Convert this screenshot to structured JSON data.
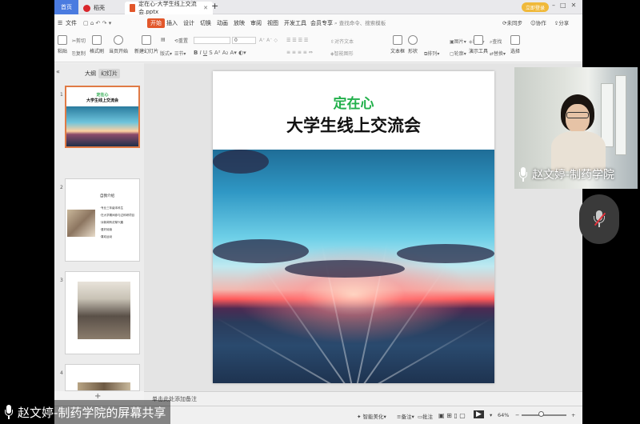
{
  "tabs": {
    "home": "首页",
    "daoke": "稻壳",
    "document": "定在心-大学生线上交流会.pptx",
    "login": "立即登录"
  },
  "menu": {
    "file": "文件",
    "start": "开始",
    "insert": "插入",
    "design": "设计",
    "transition": "切换",
    "animation": "动画",
    "slideshow": "放映",
    "review": "审阅",
    "view": "视图",
    "developer": "开发工具",
    "member": "会员专享",
    "search": "查找命令、搜索模板",
    "sync": "未同步",
    "collab": "协作",
    "share": "分享"
  },
  "ribbon": {
    "paste": "粘贴",
    "cut": "剪切",
    "copy": "复制",
    "format_painter": "格式刷",
    "start_from_current": "当页开始",
    "new_slide": "新建幻灯片",
    "layout": "版式",
    "section": "节",
    "reset": "重置",
    "font_size_value": "0",
    "text_box": "文本框",
    "shape": "形状",
    "arrange": "排列",
    "outline": "轮廓",
    "picture": "图片",
    "fill": "填充",
    "find": "查找",
    "replace": "替换",
    "select": "选择",
    "presentation_tool": "演示工具",
    "smart_shape": "智能图形",
    "text_align": "对齐文本"
  },
  "left_panel": {
    "outline_tab": "大纲",
    "slides_tab": "幻灯片",
    "slide_numbers": [
      "1",
      "2",
      "3",
      "4"
    ],
    "thumb1_title1": "定在心",
    "thumb1_title2": "大学生线上交流会",
    "thumb2_title": "自我介绍",
    "thumb2_items": [
      "·专业三年级本科生",
      "·在大学期间参与过科研项目",
      "·对新闻有浓厚兴趣",
      "·爱好阅读",
      "·喜欢运动"
    ],
    "add_icon": "+"
  },
  "slide": {
    "title1": "定在心",
    "title2": "大学生线上交流会"
  },
  "notes": {
    "placeholder": "单击此处添加备注"
  },
  "status": {
    "smart_beautify": "智能美化",
    "notes": "备注",
    "comments": "批注",
    "zoom": "64%",
    "minus": "−",
    "plus": "+"
  },
  "video": {
    "name": "赵文婷-制药学院"
  },
  "share": {
    "label": "赵文婷-制药学院的屏幕共享"
  },
  "colors": {
    "accent_orange": "#e2572b",
    "title_green": "#22b04b",
    "tab_blue": "#4a7be0"
  }
}
